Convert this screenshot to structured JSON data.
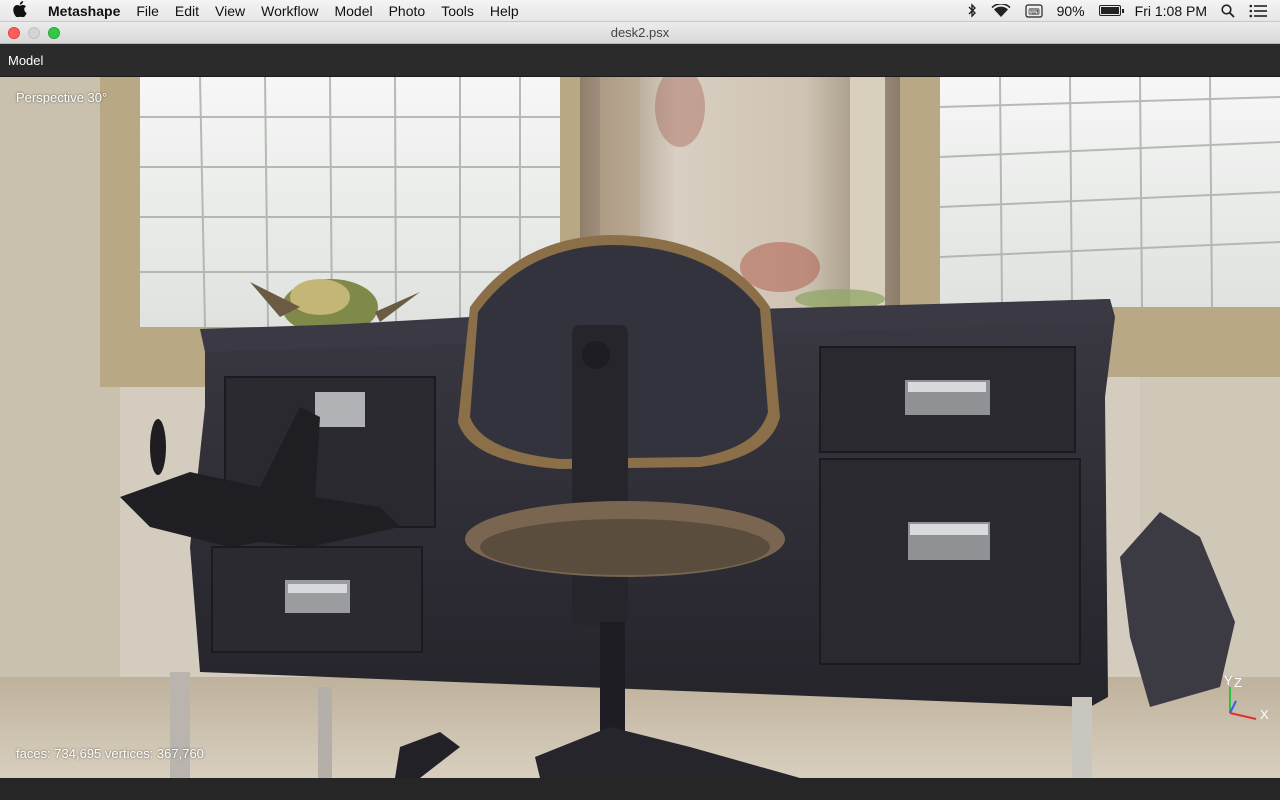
{
  "menubar": {
    "app_name": "Metashape",
    "items": [
      "File",
      "Edit",
      "View",
      "Workflow",
      "Model",
      "Photo",
      "Tools",
      "Help"
    ],
    "battery_percent": "90%",
    "battery_level": 0.9,
    "clock": "Fri 1:08 PM",
    "icons": [
      "apple-icon",
      "bluetooth-icon",
      "wifi-icon",
      "keyboard-input-icon",
      "battery-icon",
      "spotlight-search-icon",
      "notification-center-icon"
    ]
  },
  "window": {
    "title": "desk2.psx"
  },
  "panel": {
    "title": "Model"
  },
  "viewport": {
    "projection": "Perspective 30°",
    "stats": "faces: 734,695 vertices: 367,760",
    "axes": {
      "y": "Y",
      "z": "Z",
      "x": "X"
    }
  },
  "colors": {
    "axis_x": "#e03030",
    "axis_y": "#30c040",
    "axis_z": "#3060ff",
    "desk": "#2c2b33",
    "window_glass": "#f4f6f4"
  }
}
